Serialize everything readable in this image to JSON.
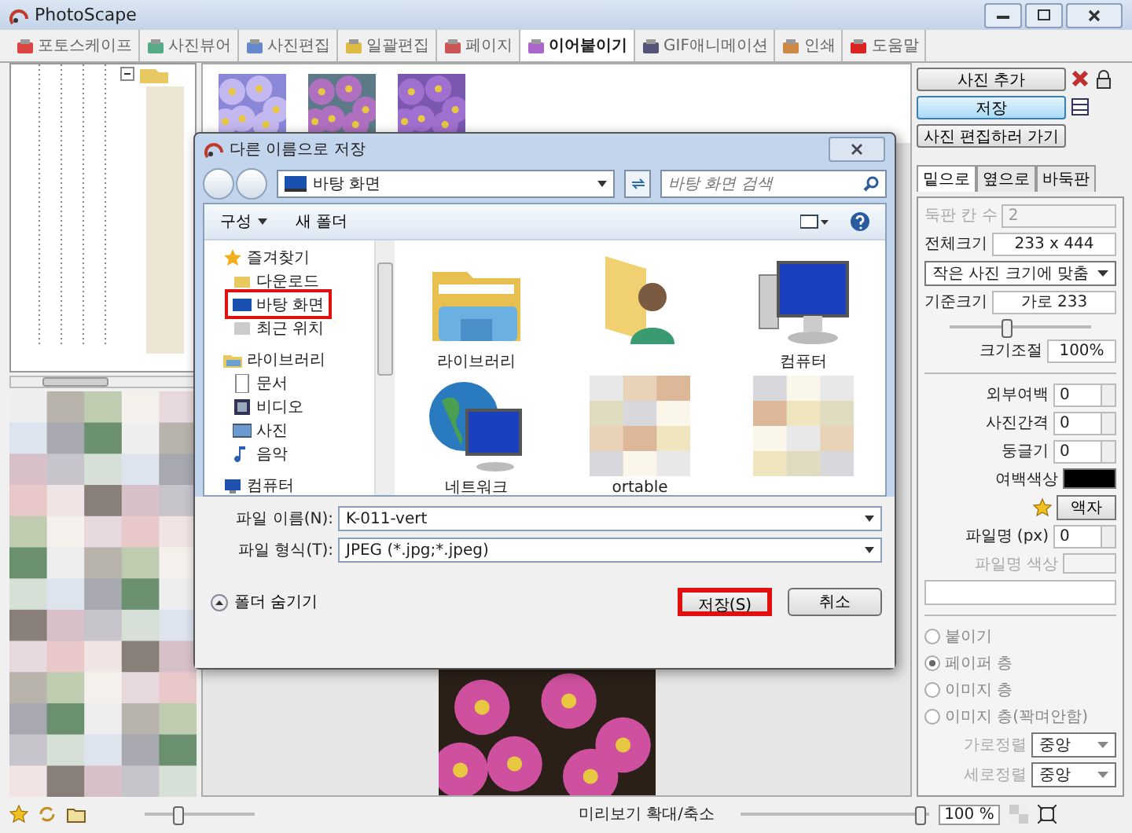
{
  "window": {
    "title": "PhotoScape"
  },
  "tabs": [
    {
      "label": "포토스케이프",
      "selected": false
    },
    {
      "label": "사진뷰어",
      "selected": false
    },
    {
      "label": "사진편집",
      "selected": false
    },
    {
      "label": "일괄편집",
      "selected": false
    },
    {
      "label": "페이지",
      "selected": false
    },
    {
      "label": "이어붙이기",
      "selected": true
    },
    {
      "label": "GIF애니메이션",
      "selected": false
    },
    {
      "label": "인쇄",
      "selected": false
    },
    {
      "label": "도움말",
      "selected": false
    }
  ],
  "right_panel": {
    "buttons": [
      {
        "label": "사진 추가",
        "kind": "normal"
      },
      {
        "label": "저장",
        "kind": "primary"
      },
      {
        "label": "사진 편집하러 가기",
        "kind": "normal"
      }
    ],
    "mode_tabs": [
      {
        "label": "밑으로",
        "selected": true
      },
      {
        "label": "옆으로",
        "selected": false
      },
      {
        "label": "바둑판",
        "selected": false
      }
    ],
    "grid_count": {
      "label": "둑판 칸 수",
      "value": "2",
      "disabled": true
    },
    "total_size": {
      "label": "전체크기",
      "value": "233 x 444"
    },
    "fit_mode": {
      "value": "작은 사진 크기에 맞춤"
    },
    "base_size": {
      "label": "기준크기",
      "value": "가로 233"
    },
    "base_slider": {
      "level": 0.4
    },
    "scale": {
      "label": "크기조절",
      "value": "100%"
    },
    "spinners": [
      {
        "label": "외부여백",
        "value": "0"
      },
      {
        "label": "사진간격",
        "value": "0"
      },
      {
        "label": "둥글기",
        "value": "0"
      }
    ],
    "margin_color": {
      "label": "여백색상",
      "color": "#000000"
    },
    "frame_button": "액자",
    "filename_size": {
      "label": "파일명 (px)",
      "value": "0"
    },
    "filename_color": {
      "label": "파일명 색상",
      "disabled": true
    },
    "radios": [
      {
        "label": "붙이기",
        "selected": false
      },
      {
        "label": "페이퍼 층",
        "selected": true
      },
      {
        "label": "이미지 층",
        "selected": false
      },
      {
        "label": "이미지 층(꽉며안함)",
        "selected": false
      }
    ],
    "aligns": [
      {
        "label": "가로정렬",
        "value": "중앙"
      },
      {
        "label": "세로정렬",
        "value": "중앙"
      }
    ]
  },
  "bottom_bar": {
    "zoom_label": "미리보기 확대/축소",
    "zoom_slider": {
      "level": 0.95
    },
    "zoom_value": "100 %",
    "left_slider": {
      "level": 0.3
    }
  },
  "dialog": {
    "title": "다른 이름으로 저장",
    "address": "바탕 화면",
    "search_placeholder": "바탕 화면 검색",
    "toolbar": [
      "구성",
      "새 폴더"
    ],
    "nav": [
      {
        "label": "즐겨찾기",
        "children": [
          {
            "label": "다운로드",
            "highlighted": false
          },
          {
            "label": "바탕 화면",
            "highlighted": true
          },
          {
            "label": "최근 위치",
            "highlighted": false
          }
        ]
      },
      {
        "label": "라이브러리",
        "children": [
          {
            "label": "문서",
            "highlighted": false
          },
          {
            "label": "비디오",
            "highlighted": false
          },
          {
            "label": "사진",
            "highlighted": false
          },
          {
            "label": "음악",
            "highlighted": false
          }
        ]
      },
      {
        "label": "컴퓨터"
      }
    ],
    "items": [
      {
        "label": "라이브러리",
        "kind": "library"
      },
      {
        "kind": "user"
      },
      {
        "label": "컴퓨터",
        "kind": "computer"
      },
      {
        "label": "네트워크",
        "kind": "network"
      },
      {
        "label": "ortable",
        "kind": "blurred"
      },
      {
        "kind": "blurred"
      }
    ],
    "file_name": {
      "label": "파일 이름(N):",
      "value": "K-011-vert"
    },
    "file_type": {
      "label": "파일 형식(T):",
      "value": "JPEG (*.jpg;*.jpeg)"
    },
    "hide_folders": "폴더 숨기기",
    "buttons": [
      {
        "label": "저장(S)",
        "highlighted": true
      },
      {
        "label": "취소",
        "highlighted": false
      }
    ]
  }
}
